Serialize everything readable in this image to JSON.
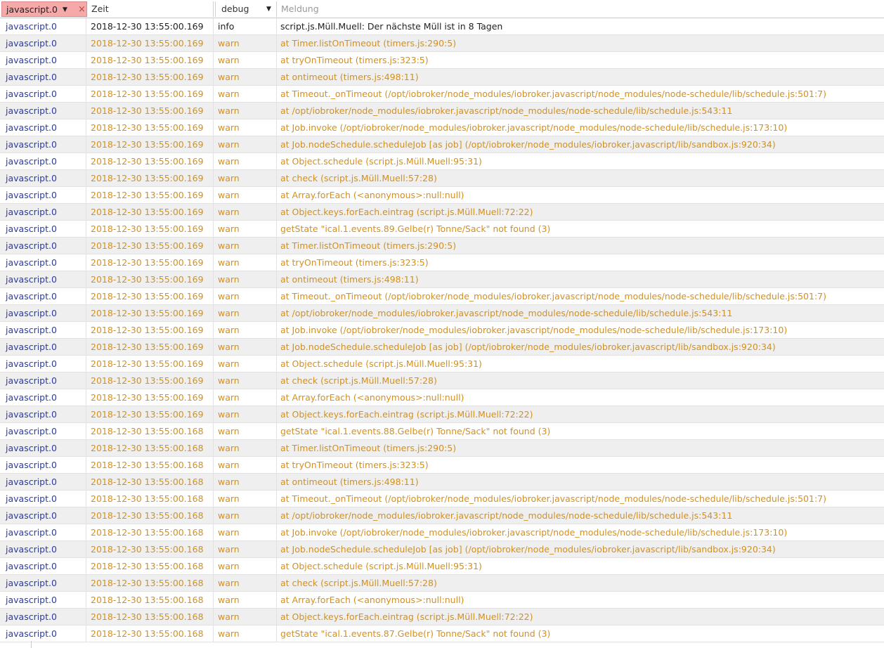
{
  "header": {
    "source_filter": "javascript.0",
    "time_label": "Zeit",
    "level_filter": "debug",
    "message_placeholder": "Meldung"
  },
  "icons": {
    "dropdown": "chevron-down-icon",
    "clear": "close-icon"
  },
  "colors": {
    "source_text": "#2a3aa8",
    "warn_text": "#d4901c",
    "info_text": "#222222",
    "filter_active_bg": "#f5a9a9"
  },
  "rows": [
    {
      "source": "javascript.0",
      "time": "2018-12-30 13:55:00.169",
      "level": "info",
      "message": "script.js.Müll.Muell: Der nächste Müll ist in 8 Tagen"
    },
    {
      "source": "javascript.0",
      "time": "2018-12-30 13:55:00.169",
      "level": "warn",
      "message": "at Timer.listOnTimeout (timers.js:290:5)"
    },
    {
      "source": "javascript.0",
      "time": "2018-12-30 13:55:00.169",
      "level": "warn",
      "message": "at tryOnTimeout (timers.js:323:5)"
    },
    {
      "source": "javascript.0",
      "time": "2018-12-30 13:55:00.169",
      "level": "warn",
      "message": "at ontimeout (timers.js:498:11)"
    },
    {
      "source": "javascript.0",
      "time": "2018-12-30 13:55:00.169",
      "level": "warn",
      "message": "at Timeout._onTimeout (/opt/iobroker/node_modules/iobroker.javascript/node_modules/node-schedule/lib/schedule.js:501:7)"
    },
    {
      "source": "javascript.0",
      "time": "2018-12-30 13:55:00.169",
      "level": "warn",
      "message": "at /opt/iobroker/node_modules/iobroker.javascript/node_modules/node-schedule/lib/schedule.js:543:11"
    },
    {
      "source": "javascript.0",
      "time": "2018-12-30 13:55:00.169",
      "level": "warn",
      "message": "at Job.invoke (/opt/iobroker/node_modules/iobroker.javascript/node_modules/node-schedule/lib/schedule.js:173:10)"
    },
    {
      "source": "javascript.0",
      "time": "2018-12-30 13:55:00.169",
      "level": "warn",
      "message": "at Job.nodeSchedule.scheduleJob [as job] (/opt/iobroker/node_modules/iobroker.javascript/lib/sandbox.js:920:34)"
    },
    {
      "source": "javascript.0",
      "time": "2018-12-30 13:55:00.169",
      "level": "warn",
      "message": "at Object.schedule (script.js.Müll.Muell:95:31)"
    },
    {
      "source": "javascript.0",
      "time": "2018-12-30 13:55:00.169",
      "level": "warn",
      "message": "at check (script.js.Müll.Muell:57:28)"
    },
    {
      "source": "javascript.0",
      "time": "2018-12-30 13:55:00.169",
      "level": "warn",
      "message": "at Array.forEach (<anonymous>:null:null)"
    },
    {
      "source": "javascript.0",
      "time": "2018-12-30 13:55:00.169",
      "level": "warn",
      "message": "at Object.keys.forEach.eintrag (script.js.Müll.Muell:72:22)"
    },
    {
      "source": "javascript.0",
      "time": "2018-12-30 13:55:00.169",
      "level": "warn",
      "message": "getState \"ical.1.events.89.Gelbe(r) Tonne/Sack\" not found (3)"
    },
    {
      "source": "javascript.0",
      "time": "2018-12-30 13:55:00.169",
      "level": "warn",
      "message": "at Timer.listOnTimeout (timers.js:290:5)"
    },
    {
      "source": "javascript.0",
      "time": "2018-12-30 13:55:00.169",
      "level": "warn",
      "message": "at tryOnTimeout (timers.js:323:5)"
    },
    {
      "source": "javascript.0",
      "time": "2018-12-30 13:55:00.169",
      "level": "warn",
      "message": "at ontimeout (timers.js:498:11)"
    },
    {
      "source": "javascript.0",
      "time": "2018-12-30 13:55:00.169",
      "level": "warn",
      "message": "at Timeout._onTimeout (/opt/iobroker/node_modules/iobroker.javascript/node_modules/node-schedule/lib/schedule.js:501:7)"
    },
    {
      "source": "javascript.0",
      "time": "2018-12-30 13:55:00.169",
      "level": "warn",
      "message": "at /opt/iobroker/node_modules/iobroker.javascript/node_modules/node-schedule/lib/schedule.js:543:11"
    },
    {
      "source": "javascript.0",
      "time": "2018-12-30 13:55:00.169",
      "level": "warn",
      "message": "at Job.invoke (/opt/iobroker/node_modules/iobroker.javascript/node_modules/node-schedule/lib/schedule.js:173:10)"
    },
    {
      "source": "javascript.0",
      "time": "2018-12-30 13:55:00.169",
      "level": "warn",
      "message": "at Job.nodeSchedule.scheduleJob [as job] (/opt/iobroker/node_modules/iobroker.javascript/lib/sandbox.js:920:34)"
    },
    {
      "source": "javascript.0",
      "time": "2018-12-30 13:55:00.169",
      "level": "warn",
      "message": "at Object.schedule (script.js.Müll.Muell:95:31)"
    },
    {
      "source": "javascript.0",
      "time": "2018-12-30 13:55:00.169",
      "level": "warn",
      "message": "at check (script.js.Müll.Muell:57:28)"
    },
    {
      "source": "javascript.0",
      "time": "2018-12-30 13:55:00.169",
      "level": "warn",
      "message": "at Array.forEach (<anonymous>:null:null)"
    },
    {
      "source": "javascript.0",
      "time": "2018-12-30 13:55:00.169",
      "level": "warn",
      "message": "at Object.keys.forEach.eintrag (script.js.Müll.Muell:72:22)"
    },
    {
      "source": "javascript.0",
      "time": "2018-12-30 13:55:00.168",
      "level": "warn",
      "message": "getState \"ical.1.events.88.Gelbe(r) Tonne/Sack\" not found (3)"
    },
    {
      "source": "javascript.0",
      "time": "2018-12-30 13:55:00.168",
      "level": "warn",
      "message": "at Timer.listOnTimeout (timers.js:290:5)"
    },
    {
      "source": "javascript.0",
      "time": "2018-12-30 13:55:00.168",
      "level": "warn",
      "message": "at tryOnTimeout (timers.js:323:5)"
    },
    {
      "source": "javascript.0",
      "time": "2018-12-30 13:55:00.168",
      "level": "warn",
      "message": "at ontimeout (timers.js:498:11)"
    },
    {
      "source": "javascript.0",
      "time": "2018-12-30 13:55:00.168",
      "level": "warn",
      "message": "at Timeout._onTimeout (/opt/iobroker/node_modules/iobroker.javascript/node_modules/node-schedule/lib/schedule.js:501:7)"
    },
    {
      "source": "javascript.0",
      "time": "2018-12-30 13:55:00.168",
      "level": "warn",
      "message": "at /opt/iobroker/node_modules/iobroker.javascript/node_modules/node-schedule/lib/schedule.js:543:11"
    },
    {
      "source": "javascript.0",
      "time": "2018-12-30 13:55:00.168",
      "level": "warn",
      "message": "at Job.invoke (/opt/iobroker/node_modules/iobroker.javascript/node_modules/node-schedule/lib/schedule.js:173:10)"
    },
    {
      "source": "javascript.0",
      "time": "2018-12-30 13:55:00.168",
      "level": "warn",
      "message": "at Job.nodeSchedule.scheduleJob [as job] (/opt/iobroker/node_modules/iobroker.javascript/lib/sandbox.js:920:34)"
    },
    {
      "source": "javascript.0",
      "time": "2018-12-30 13:55:00.168",
      "level": "warn",
      "message": "at Object.schedule (script.js.Müll.Muell:95:31)"
    },
    {
      "source": "javascript.0",
      "time": "2018-12-30 13:55:00.168",
      "level": "warn",
      "message": "at check (script.js.Müll.Muell:57:28)"
    },
    {
      "source": "javascript.0",
      "time": "2018-12-30 13:55:00.168",
      "level": "warn",
      "message": "at Array.forEach (<anonymous>:null:null)"
    },
    {
      "source": "javascript.0",
      "time": "2018-12-30 13:55:00.168",
      "level": "warn",
      "message": "at Object.keys.forEach.eintrag (script.js.Müll.Muell:72:22)"
    },
    {
      "source": "javascript.0",
      "time": "2018-12-30 13:55:00.168",
      "level": "warn",
      "message": "getState \"ical.1.events.87.Gelbe(r) Tonne/Sack\" not found (3)"
    }
  ]
}
